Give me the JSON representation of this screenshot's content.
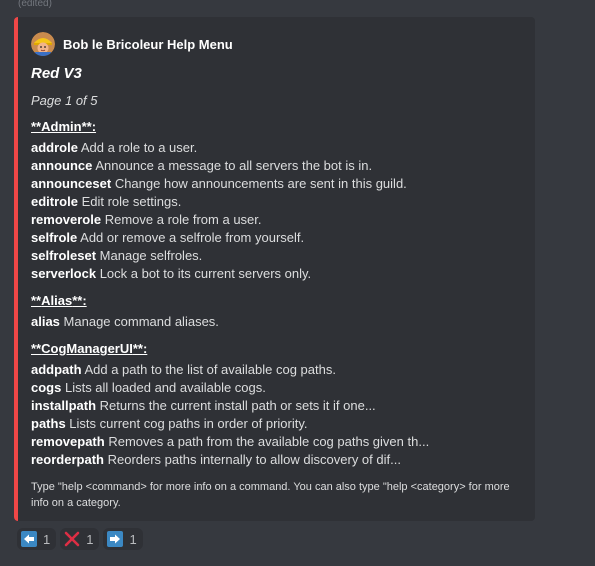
{
  "message": {
    "edited_label": "(edited)"
  },
  "embed": {
    "accent_color": "#f04747",
    "author": {
      "name": "Bob le Bricoleur Help Menu",
      "avatar_icon": "bob-builder-avatar"
    },
    "title": "Red V3",
    "page_label": "Page 1 of 5",
    "sections": [
      {
        "prefix": "**",
        "name": "Admin",
        "suffix": "**:",
        "commands": [
          {
            "name": "addrole",
            "desc": "Add a role to a user."
          },
          {
            "name": "announce",
            "desc": "Announce a message to all servers the bot is in."
          },
          {
            "name": "announceset",
            "desc": "Change how announcements are sent in this guild."
          },
          {
            "name": "editrole",
            "desc": "Edit role settings."
          },
          {
            "name": "removerole",
            "desc": "Remove a role from a user."
          },
          {
            "name": "selfrole",
            "desc": "Add or remove a selfrole from yourself."
          },
          {
            "name": "selfroleset",
            "desc": "Manage selfroles."
          },
          {
            "name": "serverlock",
            "desc": "Lock a bot to its current servers only."
          }
        ]
      },
      {
        "prefix": "**",
        "name": "Alias",
        "suffix": "**:",
        "commands": [
          {
            "name": "alias",
            "desc": "Manage command aliases."
          }
        ]
      },
      {
        "prefix": "**",
        "name": "CogManagerUI",
        "suffix": "**:",
        "commands": [
          {
            "name": "addpath",
            "desc": "Add a path to the list of available cog paths."
          },
          {
            "name": "cogs",
            "desc": "Lists all loaded and available cogs."
          },
          {
            "name": "installpath",
            "desc": "Returns the current install path or sets it if one..."
          },
          {
            "name": "paths",
            "desc": "Lists current cog paths in order of priority."
          },
          {
            "name": "removepath",
            "desc": "Removes a path from the available cog paths given th..."
          },
          {
            "name": "reorderpath",
            "desc": "Reorders paths internally to allow discovery of dif..."
          }
        ]
      }
    ],
    "footer": "Type \"help <command> for more info on a command. You can also type \"help <category> for more info on a category."
  },
  "reactions": [
    {
      "icon": "arrow-left-icon",
      "count": "1"
    },
    {
      "icon": "cross-mark-icon",
      "count": "1"
    },
    {
      "icon": "arrow-right-icon",
      "count": "1"
    }
  ]
}
